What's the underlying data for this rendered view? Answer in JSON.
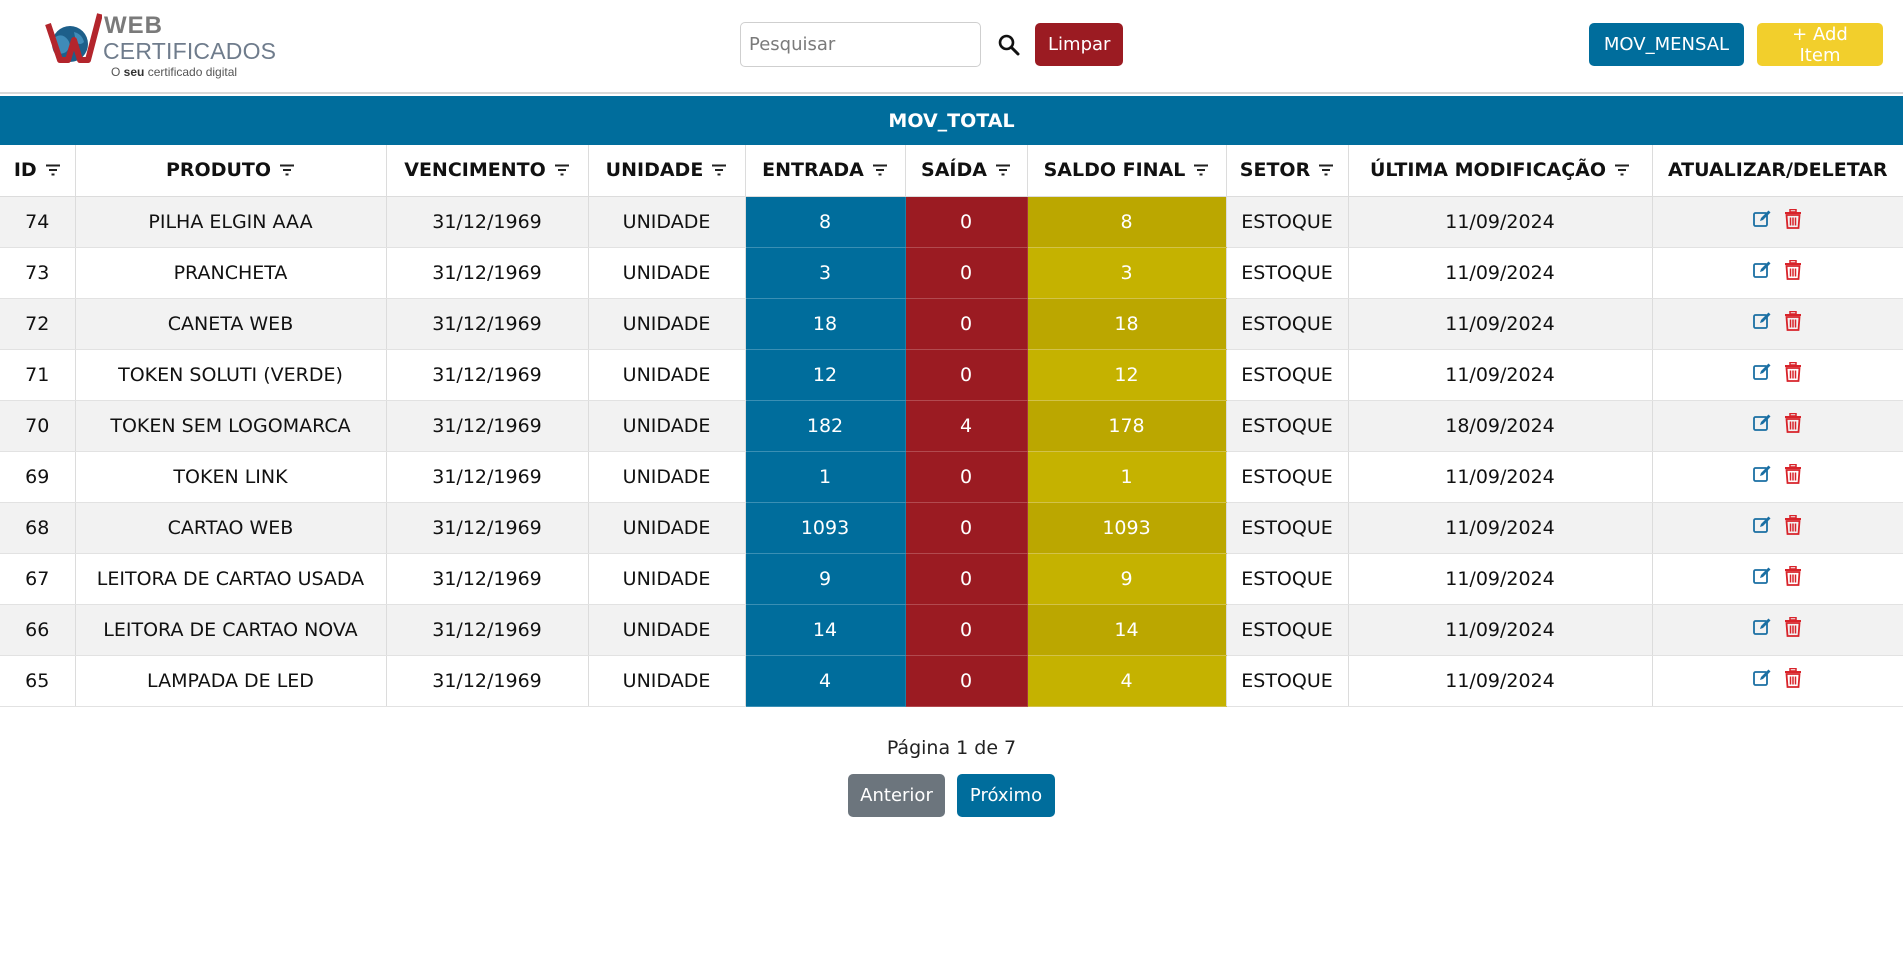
{
  "header": {
    "logo_line1": "WEB",
    "logo_line2": "CERTIFICADOS",
    "logo_tag_pre": "O ",
    "logo_tag_bold": "seu",
    "logo_tag_post": " certificado digital",
    "search_placeholder": "Pesquisar",
    "search_value": "",
    "clear_label": "Limpar",
    "monthly_label": "MOV_MENSAL",
    "add_label": "+ Add Item"
  },
  "colors": {
    "primary": "#006d9c",
    "danger": "#9b1b22",
    "warning": "#f2cf2c",
    "balance": "#c5b200",
    "secondary": "#6c757d"
  },
  "table": {
    "title": "MOV_TOTAL",
    "columns": [
      "ID",
      "PRODUTO",
      "VENCIMENTO",
      "UNIDADE",
      "ENTRADA",
      "SAÍDA",
      "SALDO FINAL",
      "SETOR",
      "ÚLTIMA MODIFICAÇÃO",
      "ATUALIZAR/DELETAR"
    ],
    "rows": [
      {
        "id": "74",
        "produto": "PILHA ELGIN AAA",
        "vencimento": "31/12/1969",
        "unidade": "UNIDADE",
        "entrada": "8",
        "saida": "0",
        "saldo": "8",
        "setor": "ESTOQUE",
        "modificacao": "11/09/2024"
      },
      {
        "id": "73",
        "produto": "PRANCHETA",
        "vencimento": "31/12/1969",
        "unidade": "UNIDADE",
        "entrada": "3",
        "saida": "0",
        "saldo": "3",
        "setor": "ESTOQUE",
        "modificacao": "11/09/2024"
      },
      {
        "id": "72",
        "produto": "CANETA WEB",
        "vencimento": "31/12/1969",
        "unidade": "UNIDADE",
        "entrada": "18",
        "saida": "0",
        "saldo": "18",
        "setor": "ESTOQUE",
        "modificacao": "11/09/2024"
      },
      {
        "id": "71",
        "produto": "TOKEN SOLUTI (VERDE)",
        "vencimento": "31/12/1969",
        "unidade": "UNIDADE",
        "entrada": "12",
        "saida": "0",
        "saldo": "12",
        "setor": "ESTOQUE",
        "modificacao": "11/09/2024"
      },
      {
        "id": "70",
        "produto": "TOKEN SEM LOGOMARCA",
        "vencimento": "31/12/1969",
        "unidade": "UNIDADE",
        "entrada": "182",
        "saida": "4",
        "saldo": "178",
        "setor": "ESTOQUE",
        "modificacao": "18/09/2024"
      },
      {
        "id": "69",
        "produto": "TOKEN LINK",
        "vencimento": "31/12/1969",
        "unidade": "UNIDADE",
        "entrada": "1",
        "saida": "0",
        "saldo": "1",
        "setor": "ESTOQUE",
        "modificacao": "11/09/2024"
      },
      {
        "id": "68",
        "produto": "CARTAO WEB",
        "vencimento": "31/12/1969",
        "unidade": "UNIDADE",
        "entrada": "1093",
        "saida": "0",
        "saldo": "1093",
        "setor": "ESTOQUE",
        "modificacao": "11/09/2024"
      },
      {
        "id": "67",
        "produto": "LEITORA DE CARTAO USADA",
        "vencimento": "31/12/1969",
        "unidade": "UNIDADE",
        "entrada": "9",
        "saida": "0",
        "saldo": "9",
        "setor": "ESTOQUE",
        "modificacao": "11/09/2024"
      },
      {
        "id": "66",
        "produto": "LEITORA DE CARTAO NOVA",
        "vencimento": "31/12/1969",
        "unidade": "UNIDADE",
        "entrada": "14",
        "saida": "0",
        "saldo": "14",
        "setor": "ESTOQUE",
        "modificacao": "11/09/2024"
      },
      {
        "id": "65",
        "produto": "LAMPADA DE LED",
        "vencimento": "31/12/1969",
        "unidade": "UNIDADE",
        "entrada": "4",
        "saida": "0",
        "saldo": "4",
        "setor": "ESTOQUE",
        "modificacao": "11/09/2024"
      }
    ]
  },
  "pagination": {
    "text": "Página 1 de 7",
    "prev_label": "Anterior",
    "next_label": "Próximo"
  }
}
